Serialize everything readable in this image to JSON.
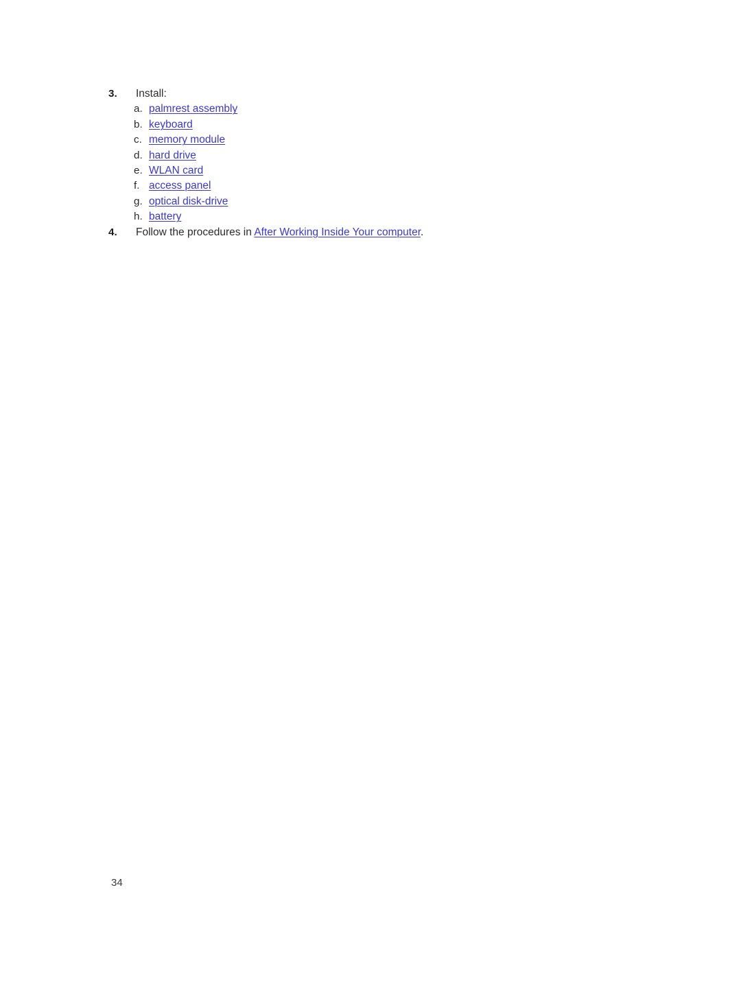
{
  "document": {
    "page_number": "34",
    "link_color": "#3b37d6",
    "text_color": "#2b2b2b"
  },
  "steps": [
    {
      "marker": "3.",
      "text": "Install:",
      "sub_items": [
        {
          "marker": "a.",
          "label": "palmrest assembly"
        },
        {
          "marker": "b.",
          "label": "keyboard"
        },
        {
          "marker": "c.",
          "label": "memory module"
        },
        {
          "marker": "d.",
          "label": "hard drive"
        },
        {
          "marker": "e.",
          "label": "WLAN card"
        },
        {
          "marker": "f.",
          "label": "access panel"
        },
        {
          "marker": "g.",
          "label": "optical disk-drive"
        },
        {
          "marker": "h.",
          "label": "battery"
        }
      ]
    },
    {
      "marker": "4.",
      "lead_text": "Follow the procedures in ",
      "link_text": "After Working Inside Your computer",
      "trail_text": "."
    }
  ]
}
